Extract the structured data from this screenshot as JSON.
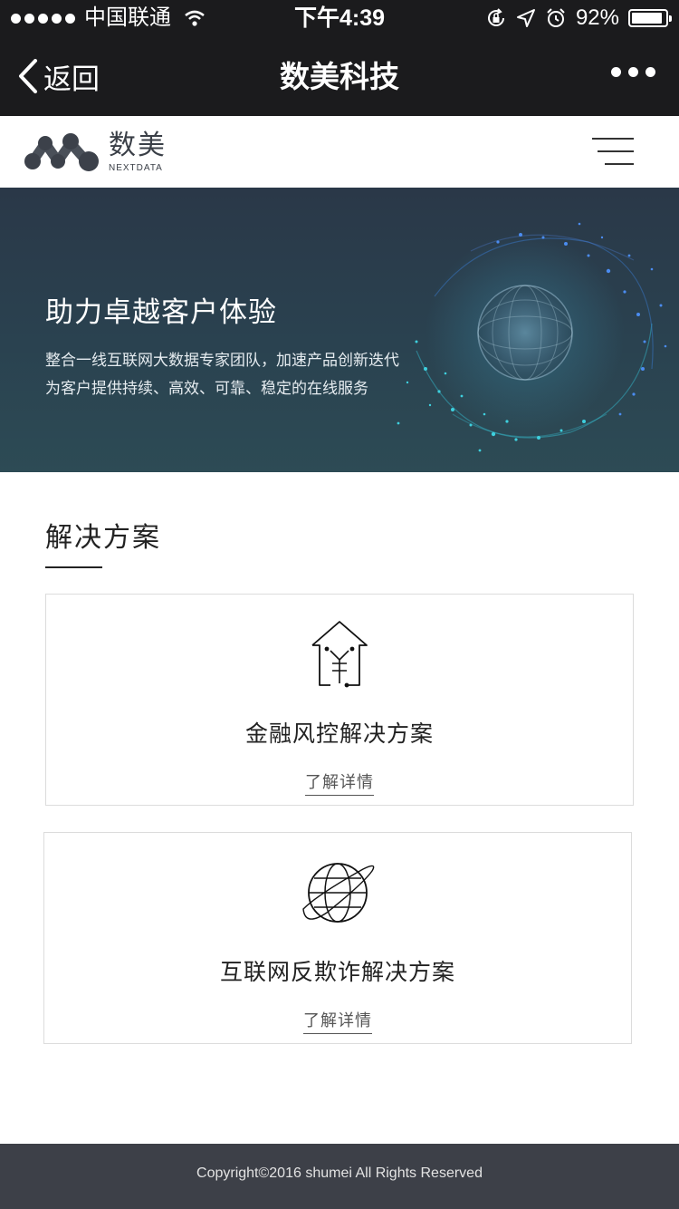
{
  "status_bar": {
    "carrier": "中国联通",
    "time": "下午4:39",
    "battery_percent": "92%",
    "battery_level": 0.92,
    "icons": [
      "signal-dots-icon",
      "wifi-icon",
      "orientation-lock-icon",
      "location-arrow-icon",
      "alarm-icon",
      "battery-icon"
    ]
  },
  "nav": {
    "back_label": "返回",
    "title": "数美科技",
    "more_icon": "more-dots-icon"
  },
  "site_header": {
    "logo_cn": "数美",
    "logo_en": "NEXTDATA",
    "menu_icon": "hamburger-menu-icon"
  },
  "hero": {
    "title": "助力卓越客户体验",
    "desc_line1": "整合一线互联网大数据专家团队，加速产品创新迭代",
    "desc_line2": "为客户提供持续、高效、可靠、稳定的在线服务"
  },
  "solutions": {
    "heading": "解决方案",
    "items": [
      {
        "icon": "house-yen-icon",
        "title": "金融风控解决方案",
        "link": "了解详情"
      },
      {
        "icon": "globe-orbit-icon",
        "title": "互联网反欺诈解决方案",
        "link": "了解详情"
      }
    ]
  },
  "footer": {
    "copyright": "Copyright©2016 shumei All Rights Reserved"
  },
  "colors": {
    "bar_background": "#1b1b1d",
    "hero_background": "#2a4250",
    "hero_glow": "#35c6d8",
    "footer_background": "#3d4048"
  }
}
